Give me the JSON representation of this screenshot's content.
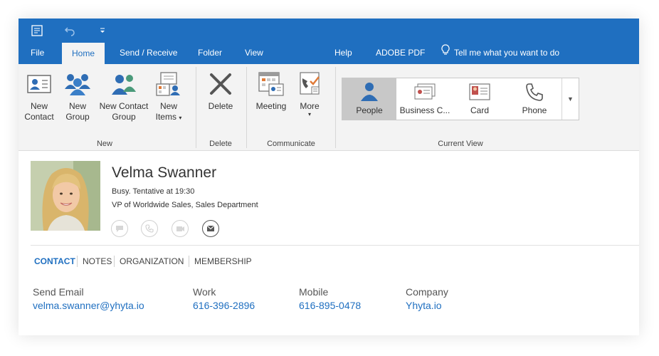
{
  "colors": {
    "accent": "#1f6fc0",
    "ribbon_bg": "#f3f3f3"
  },
  "quick_access": {
    "icons": [
      "send-receive-icon",
      "undo-icon",
      "customize-icon"
    ]
  },
  "tabs": [
    {
      "label": "File"
    },
    {
      "label": "Home",
      "active": true
    },
    {
      "label": "Send / Receive"
    },
    {
      "label": "Folder"
    },
    {
      "label": "View"
    },
    {
      "label": "Help"
    },
    {
      "label": "ADOBE PDF"
    }
  ],
  "tell_me": "Tell me what you want to do",
  "ribbon": {
    "new_group": {
      "label": "New",
      "new_contact": "New Contact",
      "new_group": "New Group",
      "new_contact_group": "New Contact Group",
      "new_items": "New Items"
    },
    "delete_group": {
      "label": "Delete",
      "delete": "Delete"
    },
    "communicate_group": {
      "label": "Communicate",
      "meeting": "Meeting",
      "more": "More"
    },
    "current_view_group": {
      "label": "Current View",
      "views": [
        {
          "label": "People",
          "selected": true
        },
        {
          "label": "Business C..."
        },
        {
          "label": "Card"
        },
        {
          "label": "Phone"
        }
      ]
    }
  },
  "contact": {
    "name": "Velma Swanner",
    "status": "Busy.  Tentative at 19:30",
    "job_title": "VP of Worldwide Sales, Sales Department",
    "actions": [
      "chat-icon",
      "phone-icon",
      "video-icon",
      "email-icon"
    ],
    "tabs": [
      "CONTACT",
      "NOTES",
      "ORGANIZATION",
      "MEMBERSHIP"
    ],
    "active_tab": "CONTACT",
    "fields": [
      {
        "label": "Send Email",
        "value": "velma.swanner@yhyta.io"
      },
      {
        "label": "Work",
        "value": "616-396-2896"
      },
      {
        "label": "Mobile",
        "value": "616-895-0478"
      },
      {
        "label": "Company",
        "value": "Yhyta.io"
      }
    ]
  }
}
